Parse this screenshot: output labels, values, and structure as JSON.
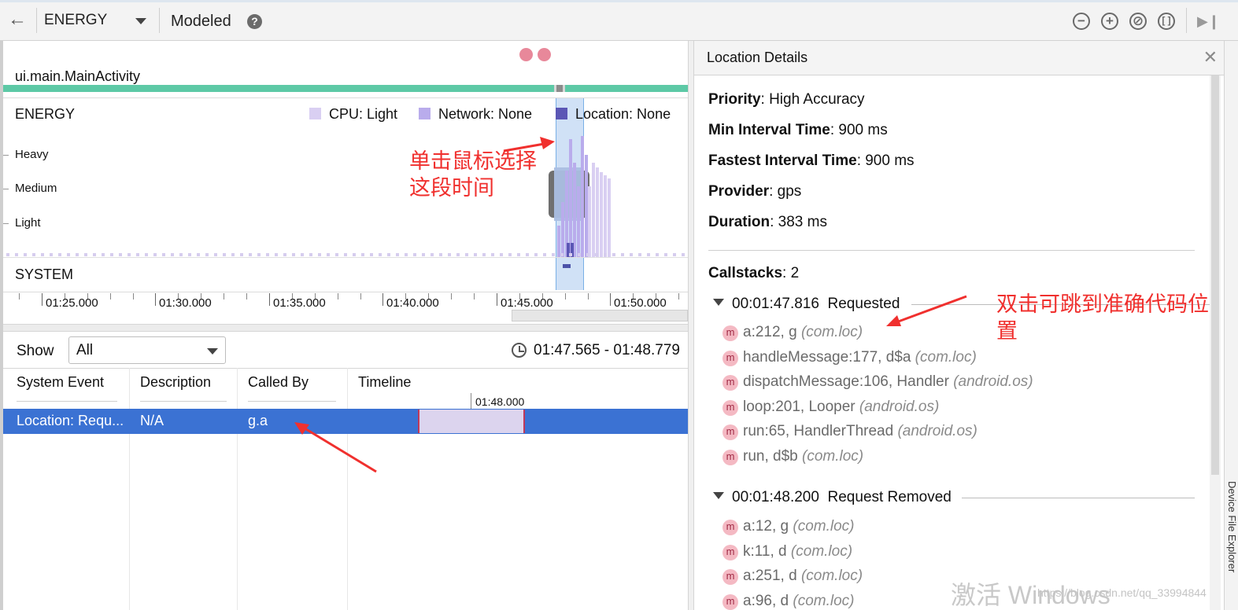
{
  "toolbar": {
    "back_icon": "arrow-left-icon",
    "profiler": "ENERGY",
    "mode": "Modeled",
    "help_icon": "question-icon",
    "icons": [
      "zoom-out-icon",
      "zoom-in-icon",
      "reset-zoom-icon",
      "fit-icon",
      "go-live-icon"
    ]
  },
  "activity": {
    "label": "ui.main.MainActivity"
  },
  "energy": {
    "title": "ENERGY",
    "legend": [
      {
        "label": "CPU: Light",
        "color": "#d9cff2"
      },
      {
        "label": "Network: None",
        "color": "#b9acec"
      },
      {
        "label": "Location: None",
        "color": "#5b57b5"
      }
    ],
    "levels": [
      "Heavy",
      "Medium",
      "Light"
    ],
    "system_title": "SYSTEM",
    "axis_labels": [
      "01:25.000",
      "01:30.000",
      "01:35.000",
      "01:40.000",
      "01:45.000",
      "01:50.000"
    ]
  },
  "events": {
    "show_label": "Show",
    "show_value": "All",
    "range": "01:47.565 - 01:48.779",
    "columns": [
      "System Event",
      "Description",
      "Called By",
      "Timeline"
    ],
    "timeline_tick": "01:48.000",
    "rows": [
      {
        "event": "Location: Requ...",
        "description": "N/A",
        "called_by": "g.a"
      }
    ]
  },
  "details": {
    "title": "Location Details",
    "properties": [
      {
        "key": "Priority",
        "value": ": High Accuracy"
      },
      {
        "key": "Min Interval Time",
        "value": ": 900 ms"
      },
      {
        "key": "Fastest Interval Time",
        "value": ": 900 ms"
      },
      {
        "key": "Provider",
        "value": ": gps"
      },
      {
        "key": "Duration",
        "value": ": 383 ms"
      }
    ],
    "callstacks_label": "Callstacks",
    "callstacks_count": ": 2",
    "callstacks": [
      {
        "time": "00:01:47.816",
        "action": "Requested",
        "frames": [
          {
            "method": "a:212, g",
            "pkg": "(com.loc)"
          },
          {
            "method": "handleMessage:177, d$a",
            "pkg": "(com.loc)"
          },
          {
            "method": "dispatchMessage:106, Handler",
            "pkg": "(android.os)"
          },
          {
            "method": "loop:201, Looper",
            "pkg": "(android.os)"
          },
          {
            "method": "run:65, HandlerThread",
            "pkg": "(android.os)"
          },
          {
            "method": "run, d$b",
            "pkg": "(com.loc)"
          }
        ]
      },
      {
        "time": "00:01:48.200",
        "action": "Request Removed",
        "frames": [
          {
            "method": "a:12, g",
            "pkg": "(com.loc)"
          },
          {
            "method": "k:11, d",
            "pkg": "(com.loc)"
          },
          {
            "method": "a:251, d",
            "pkg": "(com.loc)"
          },
          {
            "method": "a:96, d",
            "pkg": "(com.loc)"
          }
        ]
      }
    ],
    "frame_badge": "m"
  },
  "side_tab": "Device File Explorer",
  "annotations": {
    "select_range_line1": "单击鼠标选择",
    "select_range_line2": "这段时间",
    "jump_to_code_line1": "双击可跳到准确代码位",
    "jump_to_code_line2": "置"
  },
  "watermark": {
    "text": "激活 Windows",
    "url": "https://blog.csdn.net/qq_33994844"
  }
}
